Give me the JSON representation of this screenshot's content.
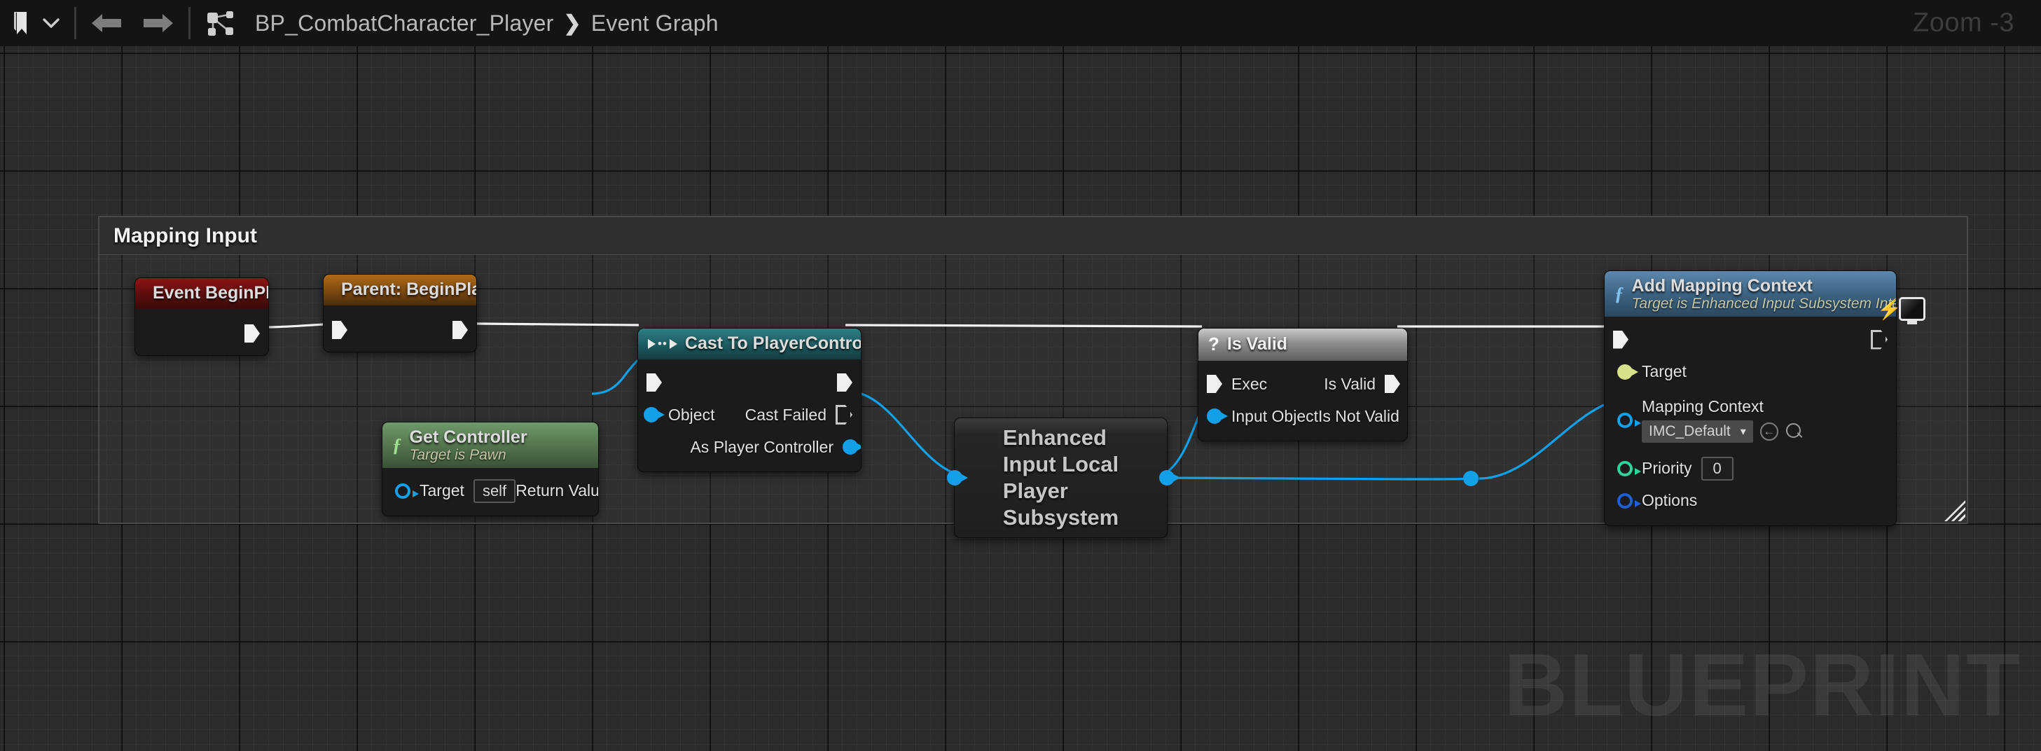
{
  "toolbar": {
    "bookmark_icon": "bookmark-icon",
    "chevron_icon": "chevron-down-icon",
    "back_icon": "back-arrow-icon",
    "forward_icon": "forward-arrow-icon",
    "graph_icon": "blueprint-graph-icon",
    "breadcrumb": {
      "root": "BP_CombatCharacter_Player",
      "separator": "❯",
      "current": "Event Graph"
    },
    "zoom_label": "Zoom -3"
  },
  "canvas": {
    "watermark": "BLUEPRINT",
    "comment": {
      "title": "Mapping Input",
      "resize_handle": "resize-handle-icon"
    }
  },
  "nodes": {
    "event_begin_play": {
      "title": "Event BeginPlay",
      "icon": "event-diamond-icon",
      "badge": "event-breakpoint-dot",
      "out_exec": ""
    },
    "parent_begin_play": {
      "title": "Parent: BeginPlay",
      "icon": "event-diamond-icon",
      "in_exec": "",
      "out_exec": ""
    },
    "get_controller": {
      "title": "Get Controller",
      "subtitle": "Target is Pawn",
      "icon": "function-f-icon",
      "target_label": "Target",
      "target_value": "self",
      "return_label": "Return Value"
    },
    "cast_to_player_controller": {
      "title": "Cast To PlayerController",
      "icon": "cast-icon",
      "object_label": "Object",
      "cast_failed_label": "Cast Failed",
      "as_player_controller_label": "As Player Controller"
    },
    "enhanced_input_subsystem": {
      "title": "Enhanced\nInput Local\nPlayer\nSubsystem"
    },
    "is_valid": {
      "title": "Is Valid",
      "icon": "question-mark-icon",
      "exec_label": "Exec",
      "input_object_label": "Input Object",
      "is_valid_label": "Is Valid",
      "is_not_valid_label": "Is Not Valid"
    },
    "add_mapping_context": {
      "title": "Add Mapping Context",
      "subtitle": "Target is Enhanced Input Subsystem Interface",
      "icon": "function-f-icon",
      "badge_icon": "client-only-monitor-icon",
      "target_label": "Target",
      "mapping_context_label": "Mapping Context",
      "mapping_context_value": "IMC_Default",
      "mapping_context_chevron": "▾",
      "browse_icon": "browse-back-icon",
      "search_icon": "search-icon",
      "priority_label": "Priority",
      "priority_value": "0",
      "options_label": "Options"
    }
  },
  "colors": {
    "exec_wire": "#f2f2f2",
    "object_wire": "#12a0e8",
    "pin_object": "#12a0e8",
    "pin_target_interface": "#d7e28a",
    "pin_priority_int": "#2fd49b",
    "pin_options_struct": "#1f5fd0",
    "canvas_bg": "#2b2b2b",
    "toolbar_bg": "#141414",
    "watermark": "#3d3d3d"
  }
}
